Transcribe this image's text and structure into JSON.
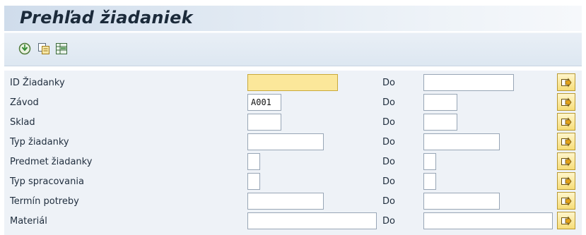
{
  "screen": {
    "title": "Prehľad žiadaniek"
  },
  "toolbar": {
    "buttons": [
      {
        "icon": "execute-icon"
      },
      {
        "icon": "copy-icon"
      },
      {
        "icon": "table-icon"
      }
    ]
  },
  "form": {
    "to_label": "Do",
    "rows": [
      {
        "label": "ID Žiadanky",
        "from_value": "",
        "to_value": ""
      },
      {
        "label": "Závod",
        "from_value": "A001",
        "to_value": ""
      },
      {
        "label": "Sklad",
        "from_value": "",
        "to_value": ""
      },
      {
        "label": "Typ žiadanky",
        "from_value": "",
        "to_value": ""
      },
      {
        "label": "Predmet žiadanky",
        "from_value": "",
        "to_value": ""
      },
      {
        "label": "Typ spracovania",
        "from_value": "",
        "to_value": ""
      },
      {
        "label": "Termín potreby",
        "from_value": "",
        "to_value": ""
      },
      {
        "label": "Materiál",
        "from_value": "",
        "to_value": ""
      }
    ],
    "multiple_selection_icon": "arrow-right-icon"
  },
  "colors": {
    "focus_field": "#fbe79a",
    "form_background": "#eef2f7",
    "multiple_selection_button": "#f7dd78"
  }
}
